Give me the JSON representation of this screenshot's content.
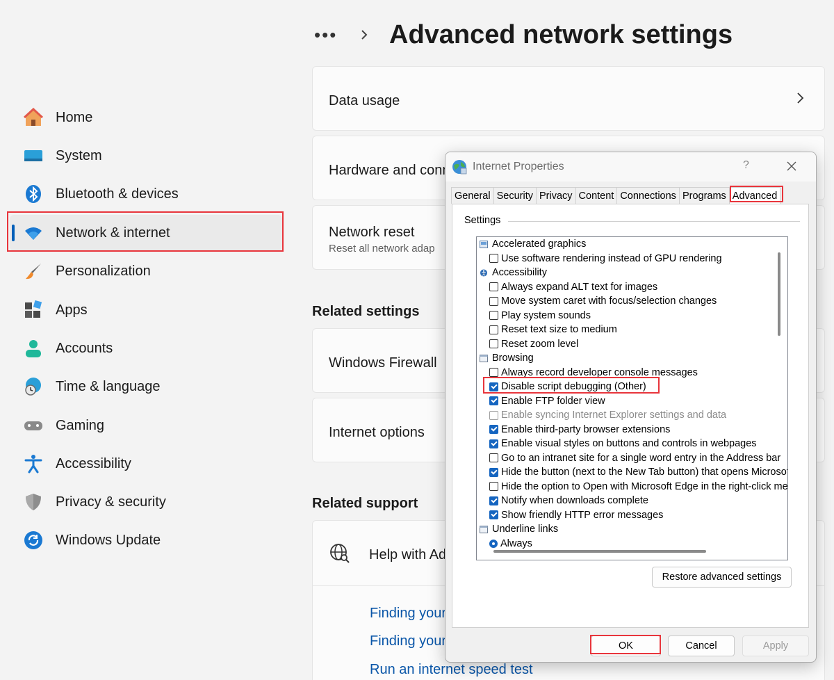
{
  "header": {
    "breadcrumb_more": "•••",
    "title": "Advanced network settings"
  },
  "sidebar": {
    "items": [
      {
        "label": "Home",
        "icon": "home-icon"
      },
      {
        "label": "System",
        "icon": "system-icon"
      },
      {
        "label": "Bluetooth & devices",
        "icon": "bluetooth-icon"
      },
      {
        "label": "Network & internet",
        "icon": "wifi-icon",
        "active": true
      },
      {
        "label": "Personalization",
        "icon": "brush-icon"
      },
      {
        "label": "Apps",
        "icon": "apps-icon"
      },
      {
        "label": "Accounts",
        "icon": "person-icon"
      },
      {
        "label": "Time & language",
        "icon": "globe-clock-icon"
      },
      {
        "label": "Gaming",
        "icon": "gamepad-icon"
      },
      {
        "label": "Accessibility",
        "icon": "accessibility-icon"
      },
      {
        "label": "Privacy & security",
        "icon": "shield-icon"
      },
      {
        "label": "Windows Update",
        "icon": "update-icon"
      }
    ]
  },
  "main": {
    "cards": [
      {
        "title": "Data usage"
      },
      {
        "title": "Hardware and conn"
      },
      {
        "title": "Network reset",
        "subtitle": "Reset all network adap"
      }
    ],
    "related_settings": {
      "title": "Related settings",
      "cards": [
        {
          "title": "Windows Firewall"
        },
        {
          "title": "Internet options"
        }
      ]
    },
    "related_support": {
      "title": "Related support",
      "help_title": "Help with Ad",
      "links": [
        "Finding your",
        "Finding your",
        "Run an internet speed test"
      ]
    }
  },
  "dialog": {
    "title": "Internet Properties",
    "help": "?",
    "tabs": [
      "General",
      "Security",
      "Privacy",
      "Content",
      "Connections",
      "Programs",
      "Advanced"
    ],
    "active_tab": "Advanced",
    "settings_label": "Settings",
    "tree": [
      {
        "type": "category",
        "label": "Accelerated graphics",
        "icon": "graphics-icon"
      },
      {
        "type": "checkbox",
        "label": "Use software rendering instead of GPU rendering",
        "checked": false
      },
      {
        "type": "category",
        "label": "Accessibility",
        "icon": "accessibility-category-icon"
      },
      {
        "type": "checkbox",
        "label": "Always expand ALT text for images",
        "checked": false
      },
      {
        "type": "checkbox",
        "label": "Move system caret with focus/selection changes",
        "checked": false
      },
      {
        "type": "checkbox",
        "label": "Play system sounds",
        "checked": false
      },
      {
        "type": "checkbox",
        "label": "Reset text size to medium",
        "checked": false
      },
      {
        "type": "checkbox",
        "label": "Reset zoom level",
        "checked": false
      },
      {
        "type": "category",
        "label": "Browsing",
        "icon": "browsing-icon"
      },
      {
        "type": "checkbox",
        "label": "Always record developer console messages",
        "checked": false
      },
      {
        "type": "checkbox",
        "label": "Disable script debugging (Other)",
        "checked": true,
        "highlighted": true
      },
      {
        "type": "checkbox",
        "label": "Enable FTP folder view",
        "checked": true
      },
      {
        "type": "checkbox",
        "label": "Enable syncing Internet Explorer settings and data",
        "checked": false,
        "disabled": true
      },
      {
        "type": "checkbox",
        "label": "Enable third-party browser extensions",
        "checked": true
      },
      {
        "type": "checkbox",
        "label": "Enable visual styles on buttons and controls in webpages",
        "checked": true
      },
      {
        "type": "checkbox",
        "label": "Go to an intranet site for a single word entry in the Address bar",
        "checked": false
      },
      {
        "type": "checkbox",
        "label": "Hide the button (next to the New Tab button) that opens Microsoft Edge",
        "checked": true
      },
      {
        "type": "checkbox",
        "label": "Hide the option to Open with Microsoft Edge in the right-click menu",
        "checked": false
      },
      {
        "type": "checkbox",
        "label": "Notify when downloads complete",
        "checked": true
      },
      {
        "type": "checkbox",
        "label": "Show friendly HTTP error messages",
        "checked": true
      },
      {
        "type": "category",
        "label": "Underline links",
        "icon": "underline-icon"
      },
      {
        "type": "radio",
        "label": "Always",
        "checked": true
      }
    ],
    "restore_button": "Restore advanced settings",
    "ok_button": "OK",
    "cancel_button": "Cancel",
    "apply_button": "Apply"
  },
  "colors": {
    "accent": "#005fb8",
    "highlight": "#e8353c",
    "link": "#0a56a8",
    "checkbox": "#1565c0"
  }
}
